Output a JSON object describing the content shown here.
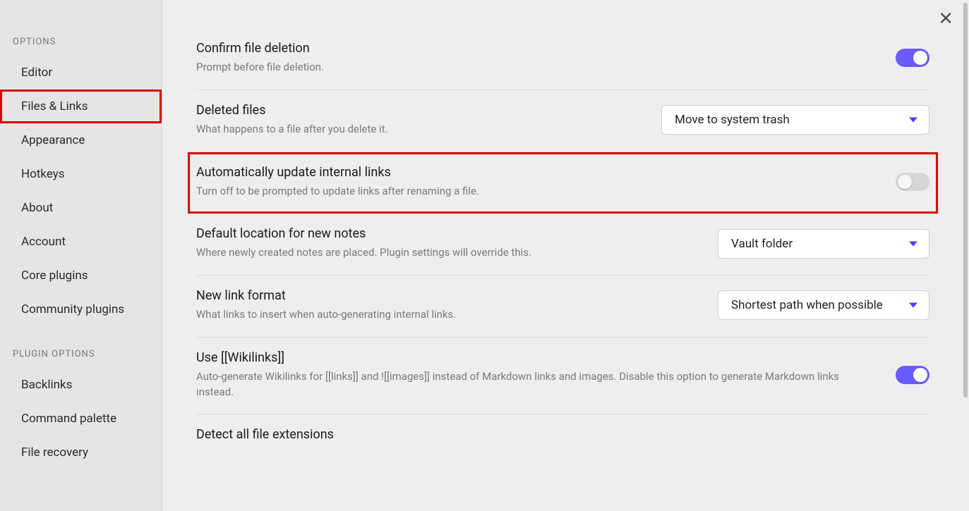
{
  "sidebar": {
    "sections": [
      {
        "heading": "Options",
        "items": [
          {
            "label": "Editor",
            "name": "sidebar-item-editor"
          },
          {
            "label": "Files & Links",
            "name": "sidebar-item-files-links",
            "active": true
          },
          {
            "label": "Appearance",
            "name": "sidebar-item-appearance"
          },
          {
            "label": "Hotkeys",
            "name": "sidebar-item-hotkeys"
          },
          {
            "label": "About",
            "name": "sidebar-item-about"
          },
          {
            "label": "Account",
            "name": "sidebar-item-account"
          },
          {
            "label": "Core plugins",
            "name": "sidebar-item-core-plugins"
          },
          {
            "label": "Community plugins",
            "name": "sidebar-item-community-plugins"
          }
        ]
      },
      {
        "heading": "Plugin options",
        "items": [
          {
            "label": "Backlinks",
            "name": "sidebar-item-backlinks"
          },
          {
            "label": "Command palette",
            "name": "sidebar-item-command-palette"
          },
          {
            "label": "File recovery",
            "name": "sidebar-item-file-recovery"
          }
        ]
      }
    ]
  },
  "settings": {
    "confirm_delete": {
      "title": "Confirm file deletion",
      "desc": "Prompt before file deletion.",
      "toggle_on": true
    },
    "deleted_files": {
      "title": "Deleted files",
      "desc": "What happens to a file after you delete it.",
      "select_value": "Move to system trash"
    },
    "auto_update_links": {
      "title": "Automatically update internal links",
      "desc": "Turn off to be prompted to update links after renaming a file.",
      "toggle_on": false,
      "highlight": true
    },
    "default_location": {
      "title": "Default location for new notes",
      "desc": "Where newly created notes are placed. Plugin settings will override this.",
      "select_value": "Vault folder"
    },
    "new_link_format": {
      "title": "New link format",
      "desc": "What links to insert when auto-generating internal links.",
      "select_value": "Shortest path when possible"
    },
    "use_wikilinks": {
      "title": "Use [[Wikilinks]]",
      "desc": "Auto-generate Wikilinks for [[links]] and ![[images]] instead of Markdown links and images. Disable this option to generate Markdown links instead.",
      "toggle_on": true
    },
    "detect_ext": {
      "title": "Detect all file extensions"
    }
  },
  "colors": {
    "accent": "#6b5cff",
    "highlight_border": "#d90000"
  }
}
